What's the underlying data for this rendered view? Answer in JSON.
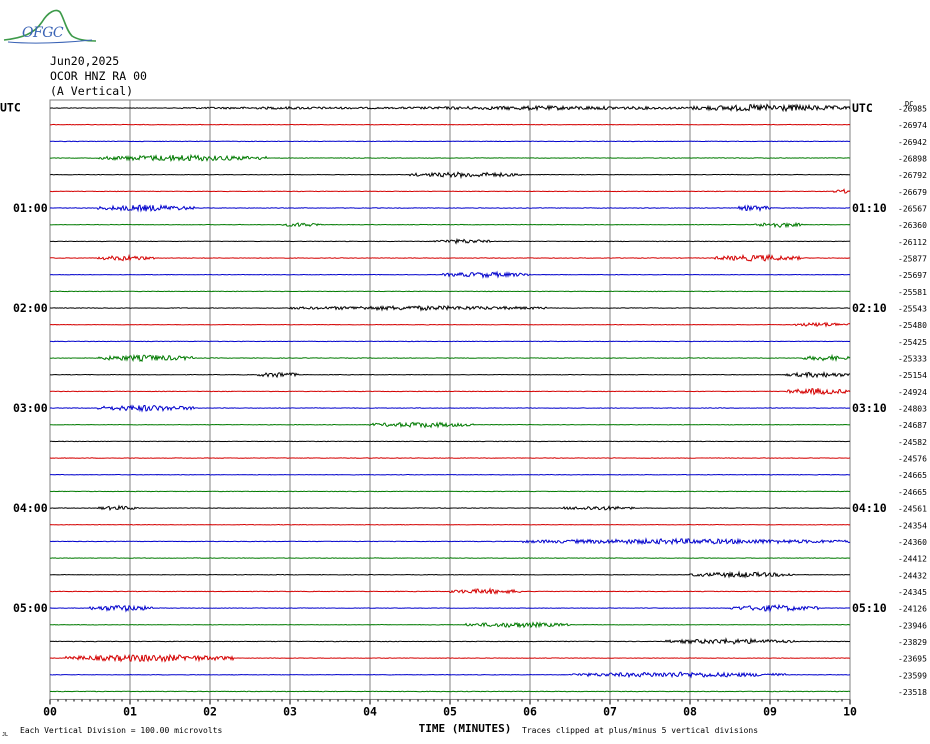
{
  "header": {
    "logo_text": "OFGC",
    "date": "Jun20,2025",
    "station": "OCOR HNZ RA 00",
    "component": "(A Vertical)"
  },
  "footer": {
    "vertical_division": "Each Vertical Division =  100.00 microvolts",
    "clip_note": "Traces clipped at plus/minus 5 vertical divisions",
    "corner_mark": "JL"
  },
  "chart_data": {
    "type": "line",
    "title": "",
    "xlabel": "TIME (MINUTES)",
    "ylabel": "",
    "xlim": [
      0,
      10
    ],
    "x_ticks": [
      "00",
      "01",
      "02",
      "03",
      "04",
      "05",
      "06",
      "07",
      "08",
      "09",
      "10"
    ],
    "left_axis_label": "UTC",
    "right_axis_label": "UTC",
    "dc_label": "DC",
    "left_time_labels": [
      {
        "row": 6,
        "text": "01:00"
      },
      {
        "row": 12,
        "text": "02:00"
      },
      {
        "row": 18,
        "text": "03:00"
      },
      {
        "row": 24,
        "text": "04:00"
      },
      {
        "row": 30,
        "text": "05:00"
      }
    ],
    "right_time_labels": [
      {
        "row": 0,
        "text": "UTC"
      },
      {
        "row": 6,
        "text": "01:10"
      },
      {
        "row": 12,
        "text": "02:10"
      },
      {
        "row": 18,
        "text": "03:10"
      },
      {
        "row": 24,
        "text": "04:10"
      },
      {
        "row": 30,
        "text": "05:10"
      }
    ],
    "trace_colors": [
      "#000000",
      "#d40000",
      "#0000cc",
      "#007a00"
    ],
    "grid_color": "#808080",
    "rows": [
      {
        "dc": "-26985",
        "bursts": [
          [
            1.6,
            4.4,
            0.1
          ],
          [
            4.4,
            8.0,
            0.18
          ],
          [
            8.0,
            10.0,
            0.35
          ]
        ]
      },
      {
        "dc": "-26974",
        "bursts": []
      },
      {
        "dc": "-26942",
        "bursts": []
      },
      {
        "dc": "-26898",
        "bursts": [
          [
            0.6,
            2.7,
            0.3
          ]
        ]
      },
      {
        "dc": "-26792",
        "bursts": [
          [
            4.5,
            5.9,
            0.25
          ]
        ]
      },
      {
        "dc": "-26679",
        "bursts": [
          [
            9.8,
            10.0,
            0.2
          ]
        ]
      },
      {
        "dc": "-26567",
        "bursts": [
          [
            0.6,
            1.8,
            0.3
          ],
          [
            8.6,
            9.0,
            0.3
          ]
        ]
      },
      {
        "dc": "-26360",
        "bursts": [
          [
            2.9,
            3.4,
            0.2
          ],
          [
            8.8,
            9.4,
            0.25
          ]
        ]
      },
      {
        "dc": "-26112",
        "bursts": [
          [
            4.8,
            5.5,
            0.2
          ]
        ]
      },
      {
        "dc": "-25877",
        "bursts": [
          [
            0.6,
            1.3,
            0.25
          ],
          [
            8.3,
            9.4,
            0.3
          ]
        ]
      },
      {
        "dc": "-25697",
        "bursts": [
          [
            4.9,
            6.0,
            0.25
          ]
        ]
      },
      {
        "dc": "-25581",
        "bursts": []
      },
      {
        "dc": "-25543",
        "bursts": [
          [
            3.0,
            6.2,
            0.2
          ]
        ]
      },
      {
        "dc": "-25480",
        "bursts": [
          [
            9.3,
            10.0,
            0.2
          ]
        ]
      },
      {
        "dc": "-25425",
        "bursts": []
      },
      {
        "dc": "-25333",
        "bursts": [
          [
            0.6,
            1.8,
            0.3
          ],
          [
            9.4,
            10.0,
            0.25
          ]
        ]
      },
      {
        "dc": "-25154",
        "bursts": [
          [
            2.6,
            3.1,
            0.25
          ],
          [
            9.2,
            10.0,
            0.25
          ]
        ]
      },
      {
        "dc": "-24924",
        "bursts": [
          [
            9.2,
            10.0,
            0.3
          ]
        ]
      },
      {
        "dc": "-24803",
        "bursts": [
          [
            0.6,
            1.8,
            0.3
          ]
        ]
      },
      {
        "dc": "-24687",
        "bursts": [
          [
            4.0,
            5.3,
            0.25
          ]
        ]
      },
      {
        "dc": "-24582",
        "bursts": []
      },
      {
        "dc": "-24576",
        "bursts": []
      },
      {
        "dc": "-24665",
        "bursts": []
      },
      {
        "dc": "-24665",
        "bursts": []
      },
      {
        "dc": "-24561",
        "bursts": [
          [
            0.6,
            1.1,
            0.2
          ],
          [
            6.4,
            7.3,
            0.2
          ]
        ]
      },
      {
        "dc": "-24354",
        "bursts": []
      },
      {
        "dc": "-24360",
        "bursts": [
          [
            5.9,
            10.0,
            0.25
          ]
        ]
      },
      {
        "dc": "-24412",
        "bursts": []
      },
      {
        "dc": "-24432",
        "bursts": [
          [
            8.0,
            9.3,
            0.25
          ]
        ]
      },
      {
        "dc": "-24345",
        "bursts": [
          [
            5.0,
            5.9,
            0.25
          ]
        ]
      },
      {
        "dc": "-24126",
        "bursts": [
          [
            0.5,
            1.3,
            0.3
          ],
          [
            8.5,
            9.6,
            0.3
          ]
        ]
      },
      {
        "dc": "-23946",
        "bursts": [
          [
            5.2,
            6.5,
            0.25
          ]
        ]
      },
      {
        "dc": "-23829",
        "bursts": [
          [
            7.7,
            9.3,
            0.25
          ]
        ]
      },
      {
        "dc": "-23695",
        "bursts": [
          [
            0.2,
            2.3,
            0.35
          ]
        ]
      },
      {
        "dc": "-23599",
        "bursts": [
          [
            6.5,
            9.2,
            0.25
          ]
        ]
      },
      {
        "dc": "-23518",
        "bursts": []
      }
    ]
  }
}
